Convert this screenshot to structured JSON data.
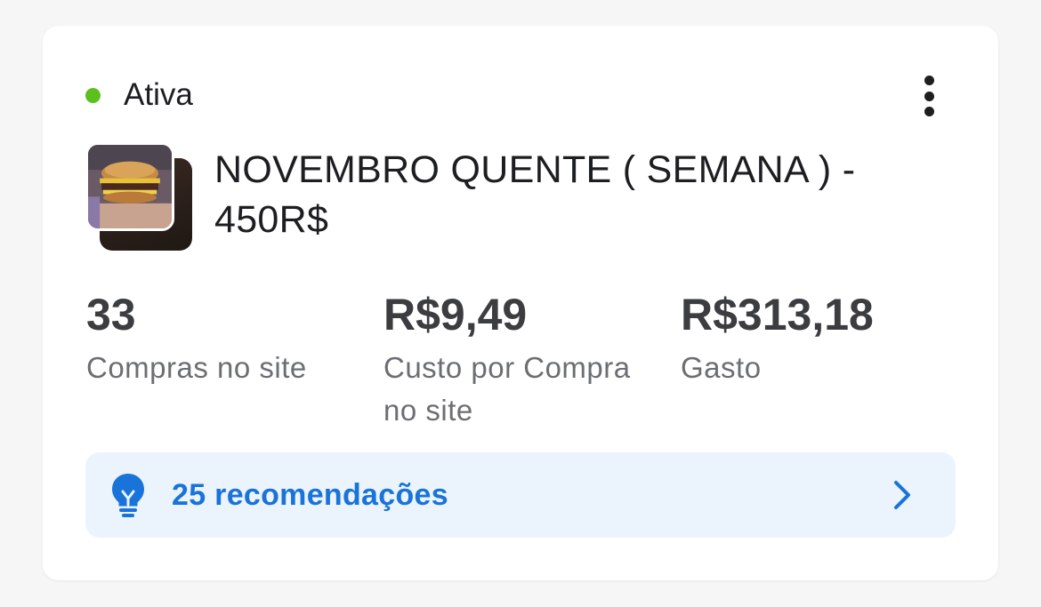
{
  "campaign": {
    "status": "Ativa",
    "status_color": "#5cbf1e",
    "title": "NOVEMBRO QUENTE ( SEMANA ) - 450R$",
    "thumbnail_icon": "burger-photo"
  },
  "metrics": [
    {
      "value": "33",
      "label": "Compras no site"
    },
    {
      "value": "R$9,49",
      "label": "Custo por Compra no site"
    },
    {
      "value": "R$313,18",
      "label": "Gasto"
    }
  ],
  "recommendations": {
    "label": "25 recomendações",
    "icon": "lightbulb-icon",
    "accent": "#1a73d9"
  }
}
